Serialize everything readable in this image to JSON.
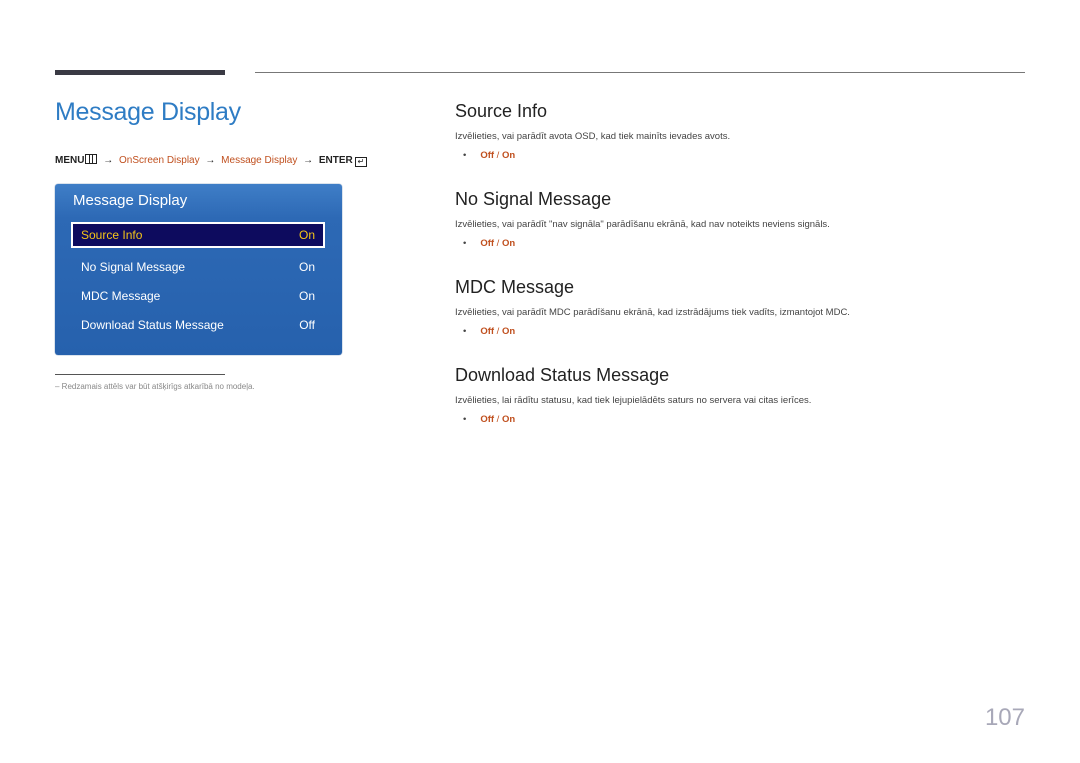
{
  "page_title": "Message Display",
  "breadcrumb": {
    "menu": "MENU",
    "arrow": "→",
    "item1": "OnScreen Display",
    "item2": "Message Display",
    "enter": "ENTER",
    "enter_glyph": "↵"
  },
  "osd": {
    "title": "Message Display",
    "rows": [
      {
        "label": "Source Info",
        "value": "On",
        "selected": true
      },
      {
        "label": "No Signal Message",
        "value": "On",
        "selected": false
      },
      {
        "label": "MDC Message",
        "value": "On",
        "selected": false
      },
      {
        "label": "Download Status Message",
        "value": "Off",
        "selected": false
      }
    ]
  },
  "footnote": "‒  Redzamais attēls var būt atšķirīgs atkarībā no modeļa.",
  "sections": [
    {
      "title": "Source Info",
      "desc": "Izvēlieties, vai parādīt avota OSD, kad tiek mainīts ievades avots.",
      "off": "Off",
      "sep": " / ",
      "on": "On"
    },
    {
      "title": "No Signal Message",
      "desc": "Izvēlieties, vai parādīt \"nav signāla\" parādīšanu ekrānā, kad nav noteikts neviens signāls.",
      "off": "Off",
      "sep": " / ",
      "on": "On"
    },
    {
      "title": "MDC Message",
      "desc": "Izvēlieties, vai parādīt MDC parādīšanu ekrānā, kad izstrādājums tiek vadīts, izmantojot MDC.",
      "off": "Off",
      "sep": " / ",
      "on": "On"
    },
    {
      "title": "Download Status Message",
      "desc": "Izvēlieties, lai rādītu statusu, kad tiek lejupielādēts saturs no servera vai citas ierīces.",
      "off": "Off",
      "sep": " / ",
      "on": "On"
    }
  ],
  "bullet": "•",
  "page_number": "107"
}
